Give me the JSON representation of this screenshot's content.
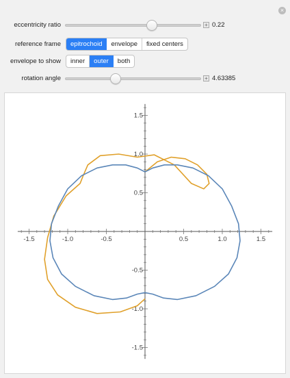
{
  "controls": {
    "eccentricity": {
      "label": "eccentricity ratio",
      "value": "0.22",
      "fraction": 0.64
    },
    "frame": {
      "label": "reference frame",
      "options": [
        "epitrochoid",
        "envelope",
        "fixed centers"
      ],
      "selected": "epitrochoid"
    },
    "envelope": {
      "label": "envelope to show",
      "options": [
        "inner",
        "outer",
        "both"
      ],
      "selected": "outer"
    },
    "rotation": {
      "label": "rotation angle",
      "value": "4.63385",
      "fraction": 0.37
    }
  },
  "close_icon": "close-circle-icon",
  "plus_icon": "plus-square-icon",
  "chart_data": {
    "type": "line",
    "xlim": [
      -1.7,
      1.7
    ],
    "ylim": [
      -1.7,
      1.7
    ],
    "x_ticks": [
      -1.5,
      -1.0,
      -0.5,
      0.5,
      1.0,
      1.5
    ],
    "x_tick_labels": [
      "-1.5",
      "-1.0",
      "-0.5",
      "0.5",
      "1.0",
      "1.5"
    ],
    "y_ticks": [
      -1.5,
      -1.0,
      -0.5,
      0.5,
      1.0,
      1.5
    ],
    "y_tick_labels": [
      "-1.5",
      "-1.0",
      "-0.5",
      "0.5",
      "1.0",
      "1.5"
    ],
    "grid": false,
    "series": [
      {
        "color": "#e0a02a",
        "description": "outer envelope",
        "x": [
          0.0,
          0.16,
          0.34,
          0.52,
          0.68,
          0.8,
          0.83,
          0.76,
          0.6,
          0.38,
          0.12,
          -0.1,
          -0.34,
          -0.58,
          -0.74,
          -0.8,
          -0.84,
          -1.02,
          -1.18,
          -1.26,
          -1.3,
          -1.26,
          -1.13,
          -0.9,
          -0.62,
          -0.32,
          -0.1,
          0.0
        ],
        "y": [
          0.77,
          0.9,
          0.96,
          0.94,
          0.86,
          0.74,
          0.62,
          0.55,
          0.62,
          0.86,
          0.99,
          0.96,
          1.0,
          0.98,
          0.86,
          0.72,
          0.62,
          0.46,
          0.2,
          -0.08,
          -0.36,
          -0.62,
          -0.82,
          -0.98,
          -1.06,
          -1.04,
          -0.96,
          -0.87
        ]
      },
      {
        "color": "#5a86b8",
        "description": "epitrochoid",
        "x": [
          0.0,
          0.1,
          0.25,
          0.42,
          0.62,
          0.82,
          1.0,
          1.12,
          1.21,
          1.23,
          1.19,
          1.08,
          0.9,
          0.66,
          0.42,
          0.24,
          0.1,
          0.0,
          -0.1,
          -0.24,
          -0.42,
          -0.66,
          -0.9,
          -1.08,
          -1.19,
          -1.23,
          -1.21,
          -1.12,
          -1.0,
          -0.82,
          -0.62,
          -0.42,
          -0.25,
          -0.1,
          0.0
        ],
        "y": [
          0.77,
          0.82,
          0.86,
          0.86,
          0.82,
          0.72,
          0.55,
          0.33,
          0.1,
          -0.12,
          -0.34,
          -0.55,
          -0.71,
          -0.83,
          -0.88,
          -0.86,
          -0.81,
          -0.79,
          -0.81,
          -0.86,
          -0.88,
          -0.83,
          -0.71,
          -0.55,
          -0.34,
          -0.12,
          0.1,
          0.33,
          0.55,
          0.72,
          0.82,
          0.86,
          0.86,
          0.82,
          0.77
        ]
      }
    ]
  }
}
